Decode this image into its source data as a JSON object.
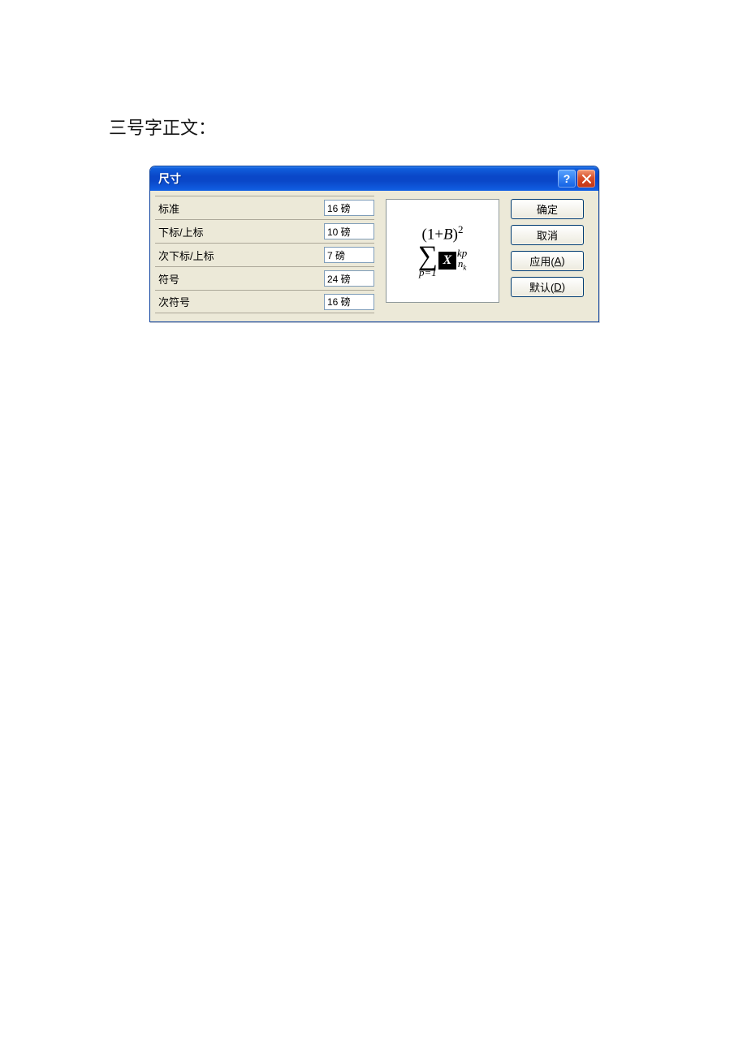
{
  "page": {
    "heading": "三号字正文："
  },
  "dialog": {
    "title": "尺寸",
    "fields": [
      {
        "label": "标准",
        "value": "16 磅"
      },
      {
        "label": "下标/上标",
        "value": "10 磅"
      },
      {
        "label": "次下标/上标",
        "value": "7 磅"
      },
      {
        "label": "符号",
        "value": "24 磅"
      },
      {
        "label": "次符号",
        "value": "16 磅"
      }
    ],
    "preview": {
      "top_left": "(1+",
      "top_var": "B",
      "top_right": ")",
      "top_exp": "2",
      "sum_lower": "p=1",
      "sup": "kp",
      "sub_main": "n",
      "sub_sub": "k"
    },
    "buttons": {
      "ok": "确定",
      "cancel": "取消",
      "apply_prefix": "应用(",
      "apply_hotkey": "A",
      "apply_suffix": ")",
      "default_prefix": "默认(",
      "default_hotkey": "D",
      "default_suffix": ")"
    }
  }
}
